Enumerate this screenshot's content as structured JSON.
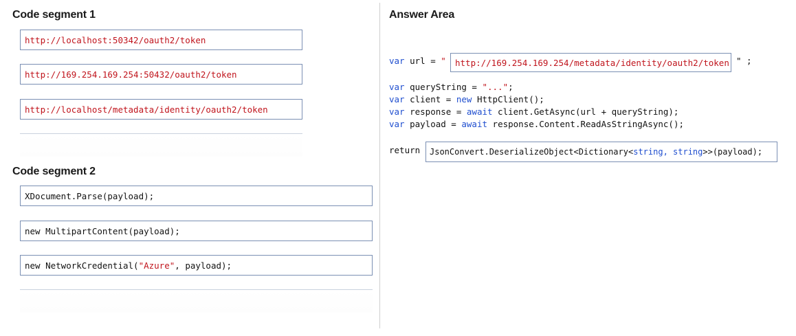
{
  "left_panel": {
    "segment1": {
      "title": "Code segment 1",
      "options": [
        "http://localhost:50342/oauth2/token",
        "http://169.254.169.254:50432/oauth2/token",
        "http://localhost/metadata/identity/oauth2/token"
      ]
    },
    "segment2": {
      "title": "Code segment 2",
      "options": [
        {
          "prefix": "XDocument.Parse(payload);",
          "string": "",
          "suffix": ""
        },
        {
          "prefix": "new MultipartContent(payload);",
          "string": "",
          "suffix": ""
        },
        {
          "prefix": "new NetworkCredential(",
          "string": "\"Azure\"",
          "suffix": ", payload);"
        }
      ]
    }
  },
  "answer_area": {
    "title": "Answer Area",
    "url_line": {
      "kw": "var",
      "pre": " url = ",
      "open_quote": "\"",
      "slot_value": "http://169.254.169.254/metadata/identity/oauth2/token",
      "close": "\" ;"
    },
    "lines": [
      {
        "kw": "var",
        "rest": " queryString = ",
        "str": "\"...\"",
        "end": ";"
      },
      {
        "kw": "var",
        "rest": " client = ",
        "kw2": "new",
        "rest2": " HttpClient();"
      },
      {
        "kw": "var",
        "rest": " response = ",
        "kw2": "await",
        "rest2": " client.GetAsync(url + queryString);"
      },
      {
        "kw": "var",
        "rest": " payload = ",
        "kw2": "await",
        "rest2": " response.Content.ReadAsStringAsync();"
      }
    ],
    "return_line": {
      "kw": "return",
      "slot_pre": "JsonConvert.DeserializeObject<Dictionary<",
      "slot_types": "string, string",
      "slot_post": ">>(payload);"
    }
  }
}
